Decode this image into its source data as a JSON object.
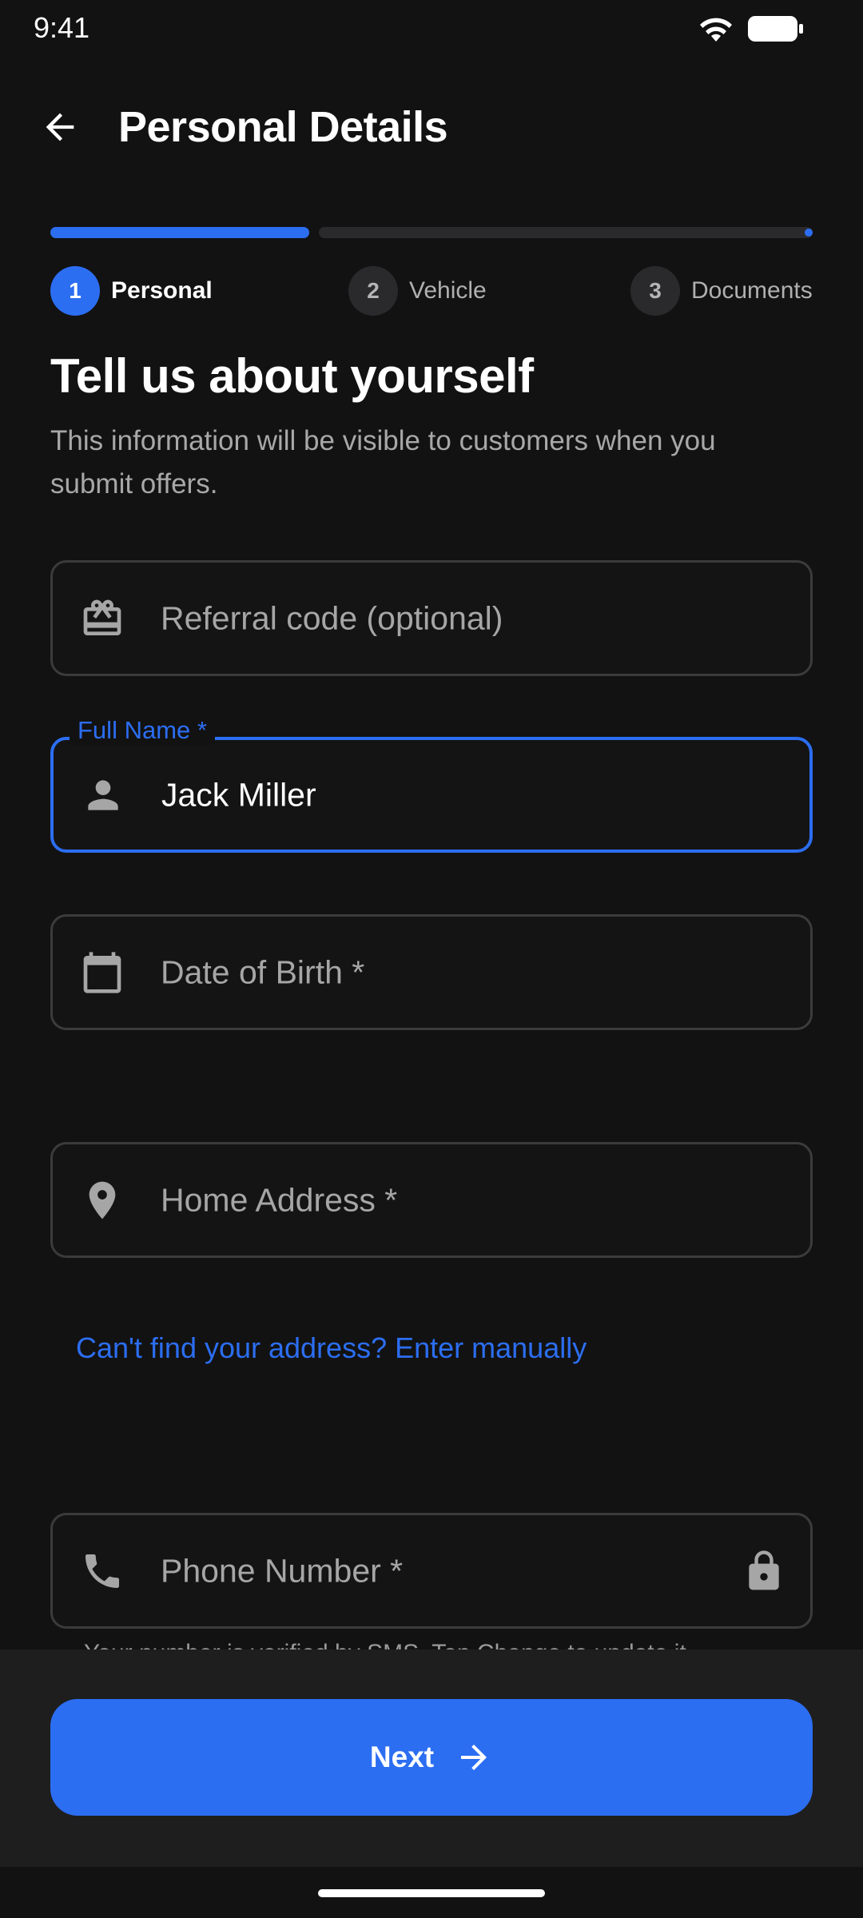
{
  "status_bar": {
    "time": "9:41"
  },
  "header": {
    "title": "Personal Details"
  },
  "progress": {
    "fraction": 0.34
  },
  "steps": [
    {
      "number": "1",
      "label": "Personal",
      "active": true
    },
    {
      "number": "2",
      "label": "Vehicle",
      "active": false
    },
    {
      "number": "3",
      "label": "Documents",
      "active": false
    }
  ],
  "intro": {
    "heading": "Tell us about yourself",
    "subheading": "This information will be visible to customers when you submit offers."
  },
  "form": {
    "referral": {
      "placeholder": "Referral code (optional)",
      "icon": "gift-card-icon"
    },
    "full_name": {
      "label": "Full Name *",
      "value": "Jack Miller",
      "icon": "person-icon"
    },
    "dob": {
      "placeholder": "Date of Birth *",
      "icon": "calendar-icon"
    },
    "address": {
      "placeholder": "Home Address *",
      "icon": "location-pin-icon"
    },
    "manual_link": "Can't find your address? Enter manually",
    "phone": {
      "placeholder": "Phone Number *",
      "icon": "phone-icon",
      "trailing_icon": "lock-icon",
      "helper": "Your number is verified by SMS. Tap Change to update it."
    }
  },
  "footer": {
    "next_label": "Next"
  },
  "colors": {
    "accent": "#2c6ef2",
    "background": "#121212",
    "field_border": "#3b3b3d"
  }
}
